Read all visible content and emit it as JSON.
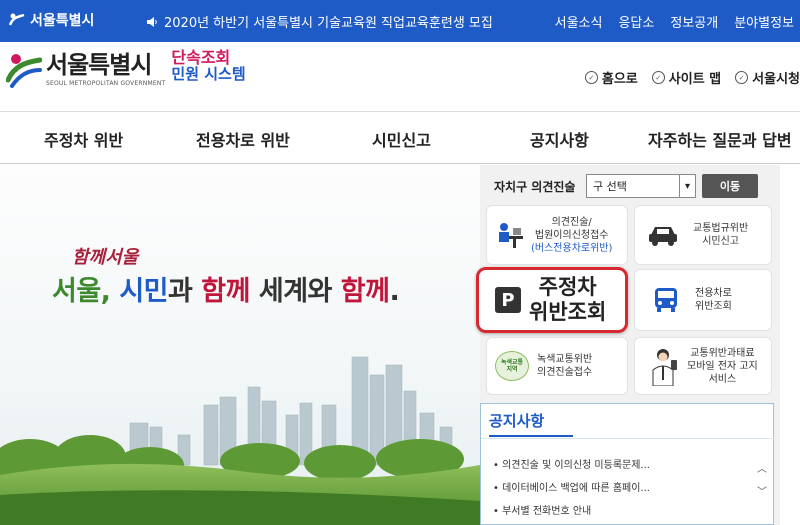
{
  "topbar": {
    "brand": "서울특별시",
    "notice_icon": "speaker-icon",
    "notice": "2020년 하반기 서울특별시 기술교육원 직업교육훈련생 모집",
    "links": [
      "서울소식",
      "응답소",
      "정보공개",
      "분야별정보"
    ]
  },
  "header": {
    "logo_main": "서울특별시",
    "logo_sub": "SEOUL METROPOLITAN GOVERNMENT",
    "system_line1": "단속조회",
    "system_line2": "민원 시스템",
    "utils": [
      "홈으로",
      "사이트 맵",
      "서울시청"
    ]
  },
  "nav": [
    "주정차 위반",
    "전용차로 위반",
    "시민신고",
    "공지사항",
    "자주하는 질문과 답변"
  ],
  "hero": {
    "tag": "함께서울",
    "slogan_1": "서울, ",
    "slogan_2": "시민",
    "slogan_3": "과 ",
    "slogan_4": "함께",
    "slogan_5": " 세계와 ",
    "slogan_6": "함께",
    "slogan_7": "."
  },
  "side": {
    "select_label": "자치구 의견진술",
    "select_value": "구 선택",
    "go_label": "이동",
    "tiles": {
      "t1_line1": "의견진술/",
      "t1_line2": "법원이의신청접수",
      "t1_line3": "(버스전용차로위반)",
      "t2_line1": "교통법규위반",
      "t2_line2": "시민신고",
      "t3_line1": "주정차",
      "t3_line2": "위반조회",
      "t4_line1": "전용차로",
      "t4_line2": "위반조회",
      "t5_line1": "녹색교통위반",
      "t5_line2": "의견진술접수",
      "t5_badge": "녹색교통지역",
      "t6_line1": "교통위반과태료",
      "t6_line2": "모바일 전자 고지",
      "t6_line3": "서비스"
    }
  },
  "notices": {
    "title": "공지사항",
    "items": [
      "의견진술 및 이의신청 미등록문제...",
      "데이터베이스 백업에 따른 홈페이...",
      "부서별 전화번호 안내"
    ]
  },
  "colors": {
    "primary_blue": "#1e5bc6",
    "accent_red": "#d8292f",
    "green": "#3d8a2e",
    "magenta": "#d0185e"
  }
}
